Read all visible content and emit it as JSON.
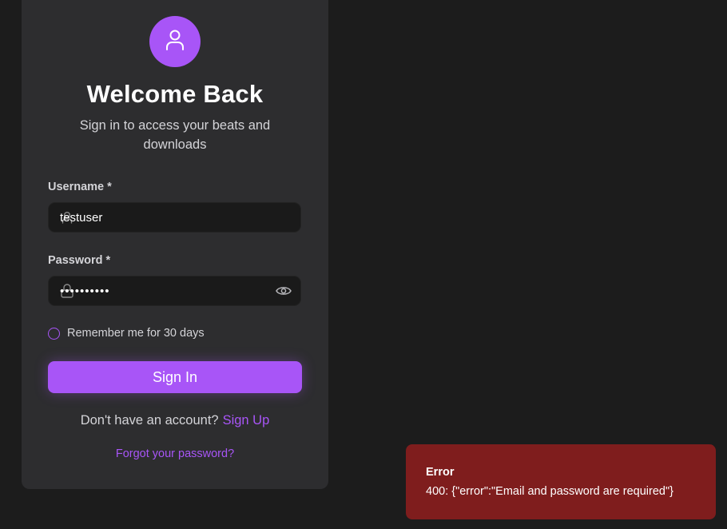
{
  "login": {
    "avatar_icon": "user-icon",
    "title": "Welcome Back",
    "subtitle": "Sign in to access your beats and downloads",
    "username": {
      "label": "Username",
      "required_mark": "*",
      "value": "testuser",
      "icon": "user-icon"
    },
    "password": {
      "label": "Password",
      "required_mark": "*",
      "value": "••••••••••",
      "icon": "lock-icon",
      "toggle_icon": "eye-icon"
    },
    "remember_label": "Remember me for 30 days",
    "remember_checked": false,
    "submit_label": "Sign In",
    "signup_prompt": "Don't have an account?",
    "signup_link": "Sign Up",
    "forgot_link": "Forgot your password?"
  },
  "toast": {
    "title": "Error",
    "message": "400: {\"error\":\"Email and password are required\"}"
  },
  "colors": {
    "background": "#1c1c1c",
    "card": "#2d2d2f",
    "accent": "#a855f7",
    "input_bg": "#1a1a1a",
    "error_bg": "#7f1d1d"
  }
}
